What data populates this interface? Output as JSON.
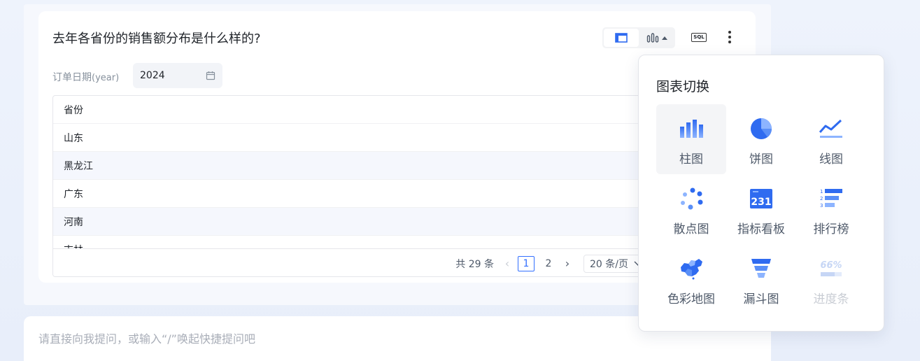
{
  "card": {
    "question": "去年各省份的销售额分布是什么样的?",
    "sql_label": "SQL"
  },
  "filter": {
    "label": "订单日期",
    "label_sub": "(year)",
    "value": "2024"
  },
  "table": {
    "header": "省份",
    "rows": [
      "山东",
      "黑龙江",
      "广东",
      "河南",
      "吉林"
    ]
  },
  "pagination": {
    "total": "共 29 条",
    "pages": [
      "1",
      "2"
    ],
    "current": "1",
    "page_size": "20 条/页"
  },
  "ask_bar": {
    "placeholder": "请直接向我提问，或输入“/”唤起快捷提问吧"
  },
  "chart_switch": {
    "title": "图表切换",
    "options": [
      {
        "label": "柱图",
        "icon": "bar-chart-icon",
        "selected": true
      },
      {
        "label": "饼图",
        "icon": "pie-chart-icon"
      },
      {
        "label": "线图",
        "icon": "line-chart-icon"
      },
      {
        "label": "散点图",
        "icon": "scatter-chart-icon"
      },
      {
        "label": "指标看板",
        "icon": "metric-board-icon",
        "metric_value": "231"
      },
      {
        "label": "排行榜",
        "icon": "ranking-icon"
      },
      {
        "label": "色彩地图",
        "icon": "color-map-icon"
      },
      {
        "label": "漏斗图",
        "icon": "funnel-chart-icon"
      },
      {
        "label": "进度条",
        "icon": "progress-bar-icon",
        "disabled": true,
        "metric_value": "66%"
      }
    ]
  },
  "colors": {
    "accent": "#3370ff",
    "icon_blue": "#2f6bf0",
    "icon_light": "#8db4ff"
  }
}
